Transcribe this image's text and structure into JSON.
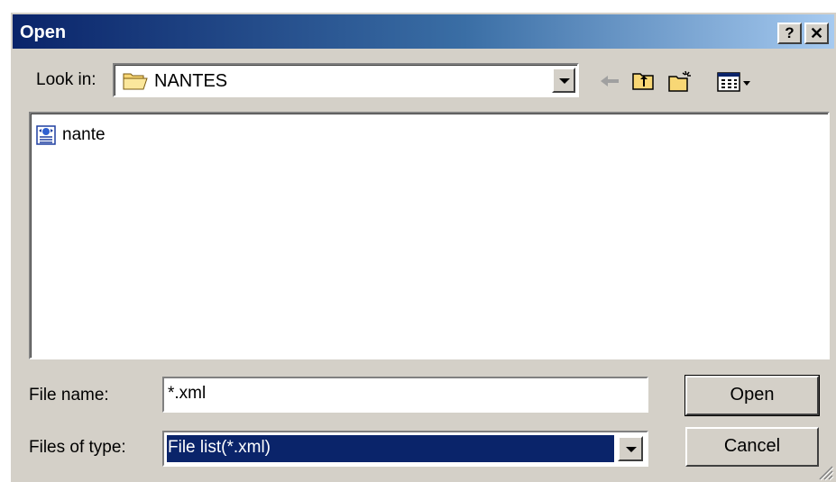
{
  "window": {
    "title": "Open",
    "help_label": "?",
    "close_label": "✕"
  },
  "look_in": {
    "label": "Look in:",
    "value": "NANTES",
    "icon": "folder-icon"
  },
  "toolbar": {
    "back_icon": "back-arrow-icon",
    "up_icon": "up-folder-icon",
    "new_folder_icon": "new-folder-icon",
    "view_menu_icon": "view-menu-icon"
  },
  "files": [
    {
      "name": "nante",
      "icon": "xml-file-icon"
    }
  ],
  "file_name": {
    "label": "File name:",
    "value": "*.xml"
  },
  "file_type": {
    "label": "Files of type:",
    "value": "File list(*.xml)"
  },
  "buttons": {
    "open": "Open",
    "cancel": "Cancel"
  },
  "colors": {
    "title_start": "#0a246a",
    "title_end": "#a6caf0",
    "face": "#d4d0c8",
    "selection": "#0a246a"
  }
}
